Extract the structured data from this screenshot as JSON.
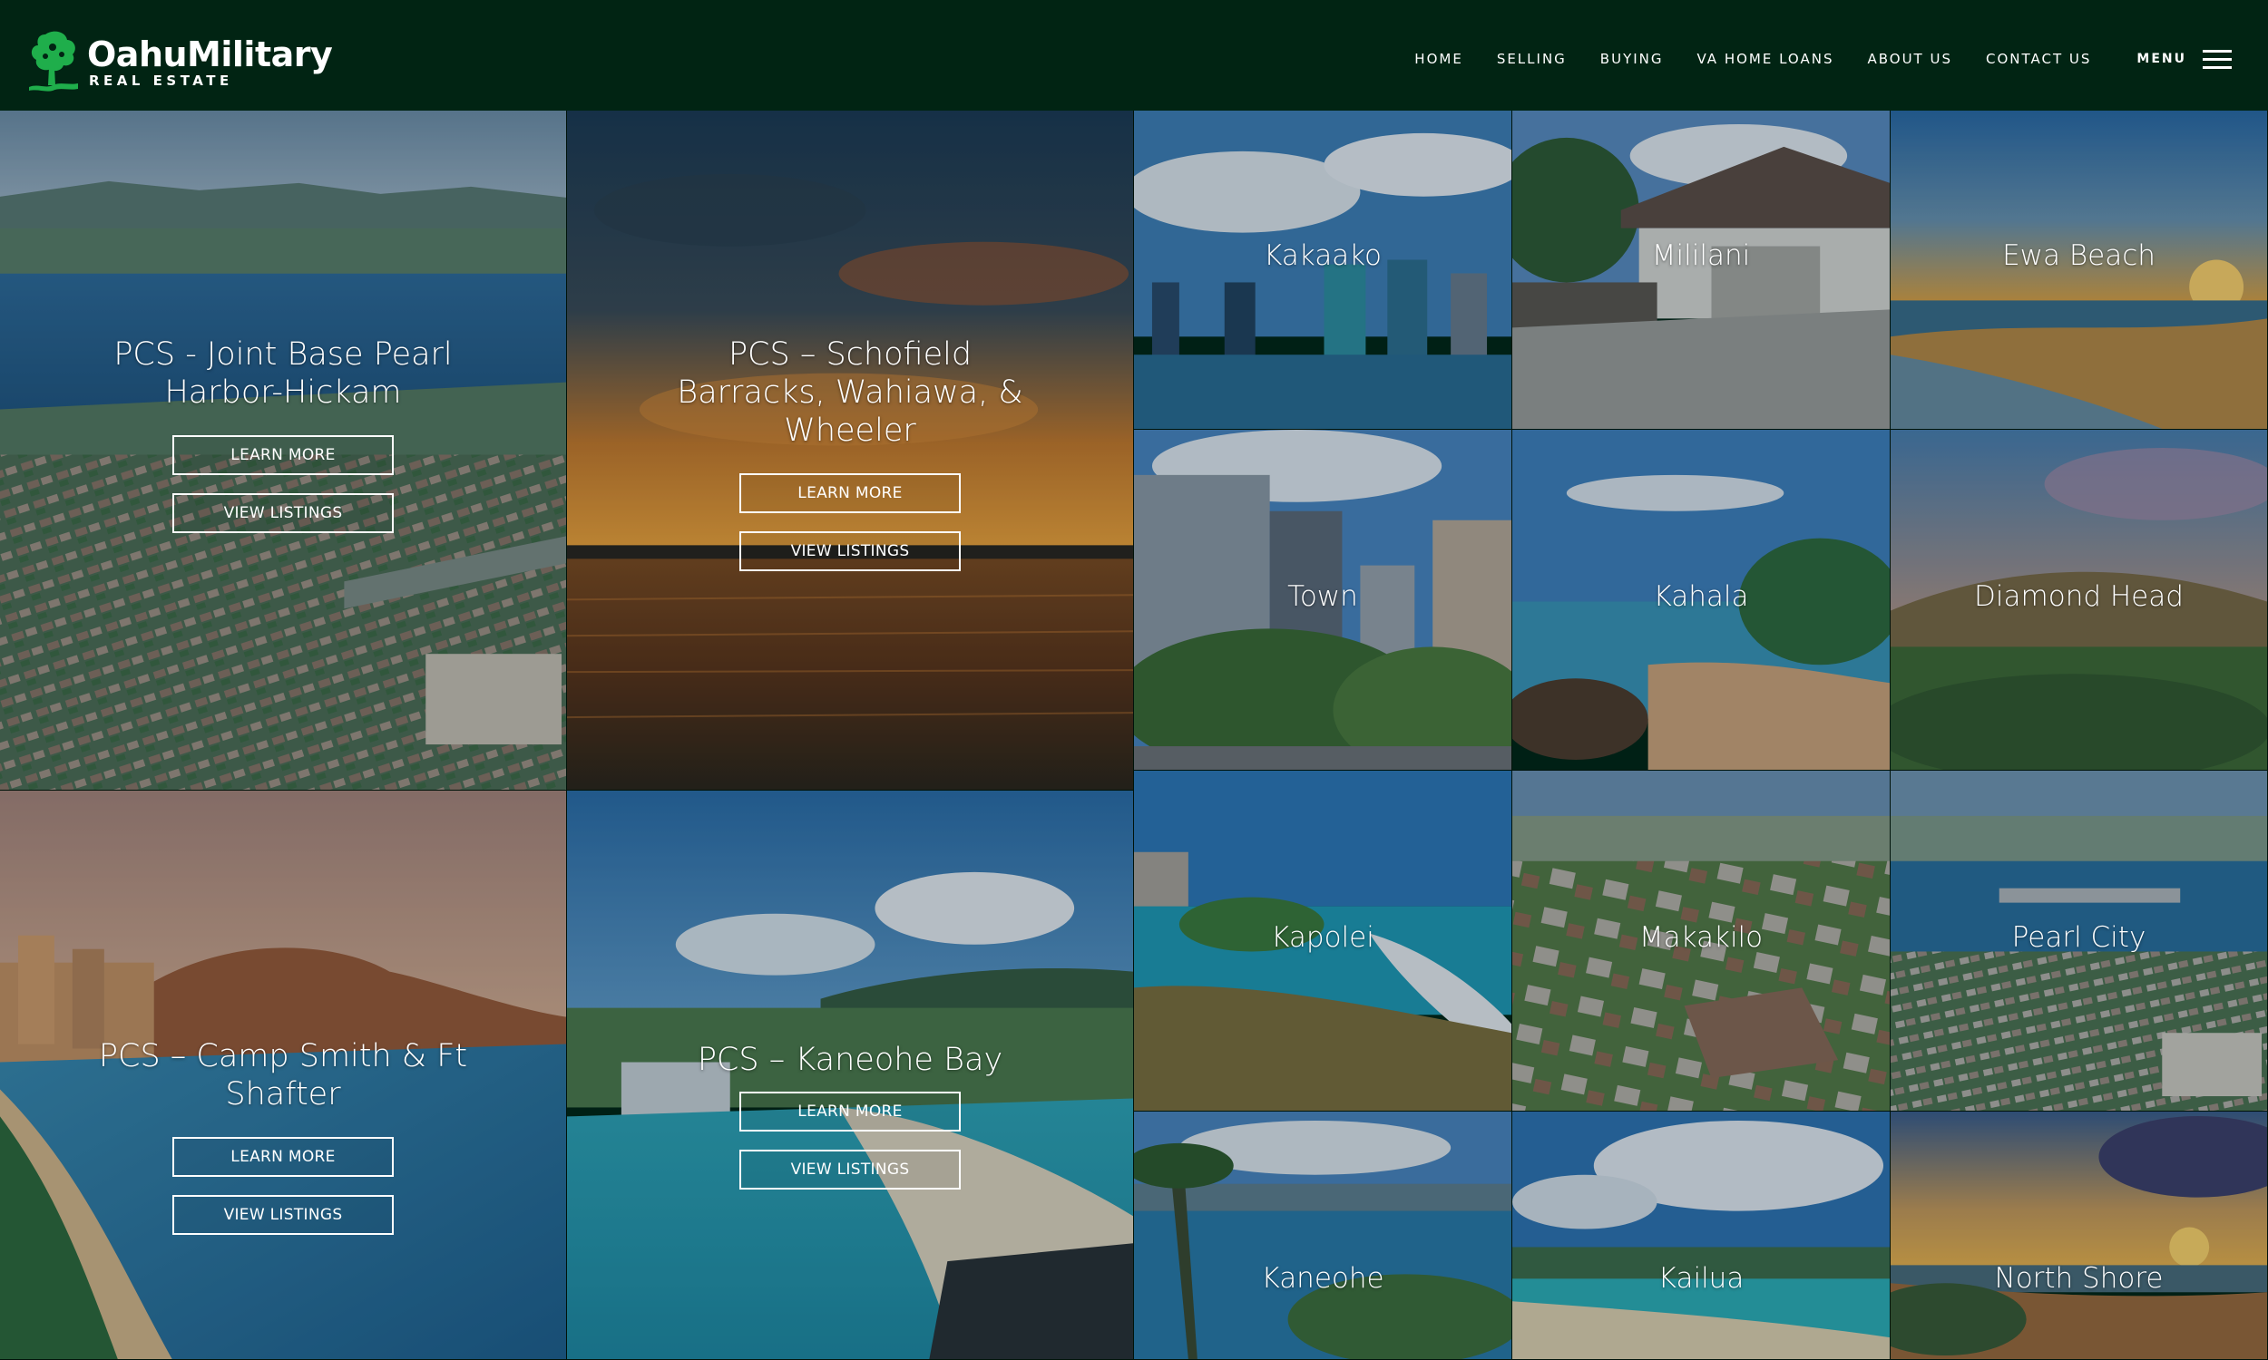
{
  "brand": {
    "name": "OahuMilitary",
    "subtitle": "REAL ESTATE",
    "logo_icon": "hawaiian-islands-tree-icon",
    "logo_color": "#1fae4b"
  },
  "nav": {
    "items": [
      "HOME",
      "SELLING",
      "BUYING",
      "VA HOME LOANS",
      "ABOUT US",
      "CONTACT US"
    ],
    "menu_label": "MENU",
    "menu_icon": "hamburger-icon"
  },
  "colors": {
    "header_bg": "#012413",
    "button_border": "#ffffff"
  },
  "bases": [
    {
      "title": "PCS - Joint Base Pearl Harbor-Hickam",
      "learn_more": "LEARN MORE",
      "view_listings": "VIEW LISTINGS"
    },
    {
      "title": "PCS – Schofield Barracks, Wahiawa, & Wheeler",
      "learn_more": "LEARN MORE",
      "view_listings": "VIEW LISTINGS"
    },
    {
      "title": "PCS – Camp Smith & Ft Shafter",
      "learn_more": "LEARN MORE",
      "view_listings": "VIEW LISTINGS"
    },
    {
      "title": "PCS – Kaneohe Bay",
      "learn_more": "LEARN MORE",
      "view_listings": "VIEW LISTINGS"
    }
  ],
  "neighborhoods": [
    "Kakaako",
    "Mililani",
    "Ewa Beach",
    "Town",
    "Kahala",
    "Diamond Head",
    "Kapolei",
    "Makakilo",
    "Pearl City",
    "Kaneohe",
    "Kailua",
    "North Shore"
  ]
}
